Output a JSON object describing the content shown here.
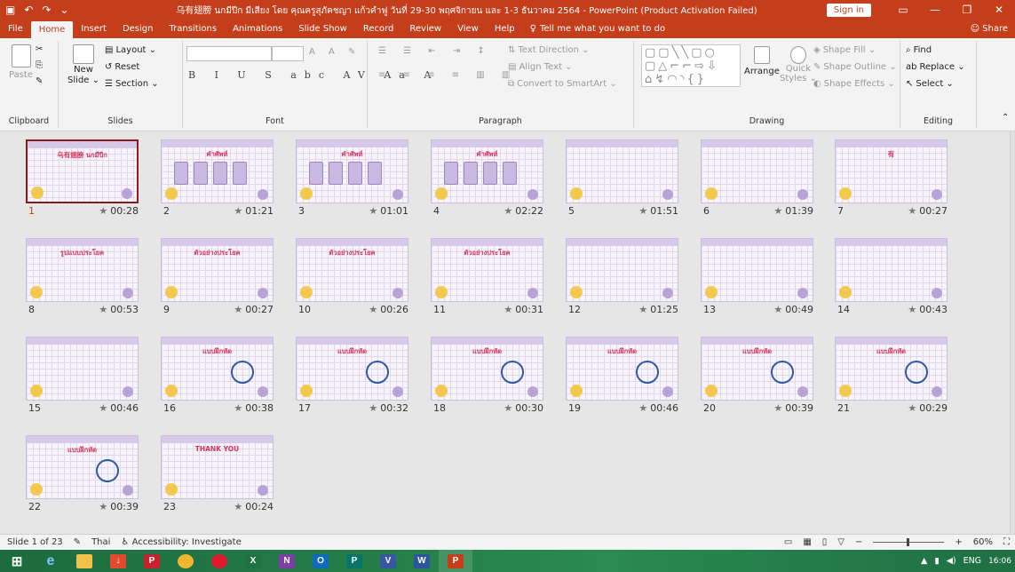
{
  "titlebar": {
    "title": "乌有翅膀 นกมีปีก มีเสียง โดย คุณครูสุภัคชญา แก้วคำฟู วันที่ 29-30 พฤศจิกายน และ 1-3 ธันวาคม 2564 - PowerPoint (Product Activation Failed)",
    "sign_in": "Sign in",
    "save_icon": "save-icon",
    "undo_icon": "undo-icon",
    "redo_icon": "redo-icon"
  },
  "tabs": [
    "File",
    "Home",
    "Insert",
    "Design",
    "Transitions",
    "Animations",
    "Slide Show",
    "Record",
    "Review",
    "View",
    "Help"
  ],
  "active_tab": "Home",
  "tell_me": "Tell me what you want to do",
  "share": "Share",
  "ribbon": {
    "clipboard": {
      "label": "Clipboard",
      "paste": "Paste"
    },
    "slides": {
      "label": "Slides",
      "new_slide_1": "New",
      "new_slide_2": "Slide ⌄",
      "layout": "Layout ⌄",
      "reset": "Reset",
      "section": "Section ⌄"
    },
    "font": {
      "label": "Font",
      "format_buttons": "B I U S abc AV Aa A"
    },
    "paragraph": {
      "label": "Paragraph",
      "text_direction": "Text Direction ⌄",
      "align_text": "Align Text ⌄",
      "convert_smartart": "Convert to SmartArt ⌄"
    },
    "drawing": {
      "label": "Drawing",
      "arrange": "Arrange",
      "quick_styles_1": "Quick",
      "quick_styles_2": "Styles ⌄",
      "shape_fill": "Shape Fill ⌄",
      "shape_outline": "Shape Outline ⌄",
      "shape_effects": "Shape Effects ⌄"
    },
    "editing": {
      "label": "Editing",
      "find": "Find",
      "replace": "Replace ⌄",
      "select": "Select ⌄"
    }
  },
  "slides": [
    {
      "num": "1",
      "duration": "00:28",
      "title": "乌有翅膀 นกมีปีก"
    },
    {
      "num": "2",
      "duration": "01:21",
      "title": "คำศัพท์"
    },
    {
      "num": "3",
      "duration": "01:01",
      "title": "คำศัพท์"
    },
    {
      "num": "4",
      "duration": "02:22",
      "title": "คำศัพท์"
    },
    {
      "num": "5",
      "duration": "01:51",
      "title": ""
    },
    {
      "num": "6",
      "duration": "01:39",
      "title": ""
    },
    {
      "num": "7",
      "duration": "00:27",
      "title": "有"
    },
    {
      "num": "8",
      "duration": "00:53",
      "title": "รูปแบบประโยค"
    },
    {
      "num": "9",
      "duration": "00:27",
      "title": "ตัวอย่างประโยค"
    },
    {
      "num": "10",
      "duration": "00:26",
      "title": "ตัวอย่างประโยค"
    },
    {
      "num": "11",
      "duration": "00:31",
      "title": "ตัวอย่างประโยค"
    },
    {
      "num": "12",
      "duration": "01:25",
      "title": ""
    },
    {
      "num": "13",
      "duration": "00:49",
      "title": ""
    },
    {
      "num": "14",
      "duration": "00:43",
      "title": ""
    },
    {
      "num": "15",
      "duration": "00:46",
      "title": ""
    },
    {
      "num": "16",
      "duration": "00:38",
      "title": "แบบฝึกหัด"
    },
    {
      "num": "17",
      "duration": "00:32",
      "title": "แบบฝึกหัด"
    },
    {
      "num": "18",
      "duration": "00:30",
      "title": "แบบฝึกหัด"
    },
    {
      "num": "19",
      "duration": "00:46",
      "title": "แบบฝึกหัด"
    },
    {
      "num": "20",
      "duration": "00:39",
      "title": "แบบฝึกหัด"
    },
    {
      "num": "21",
      "duration": "00:29",
      "title": "แบบฝึกหัด"
    },
    {
      "num": "22",
      "duration": "00:39",
      "title": "แบบฝึกหัด"
    },
    {
      "num": "23",
      "duration": "00:24",
      "title": "THANK YOU"
    }
  ],
  "selected_slide": "1",
  "status": {
    "slide_info": "Slide 1 of 23",
    "language": "Thai",
    "accessibility": "Accessibility: Investigate",
    "zoom": "60%"
  },
  "taskbar": {
    "lang": "ENG",
    "time": "16:06"
  },
  "colors": {
    "accent": "#c43e1c",
    "selected_border": "#8b1a1a",
    "taskbar": "#2a8a4f"
  }
}
